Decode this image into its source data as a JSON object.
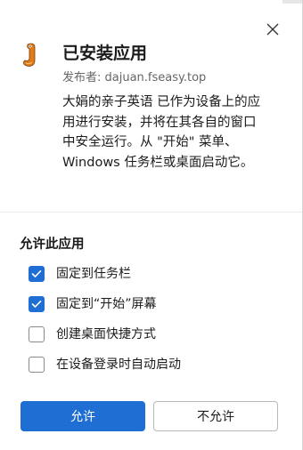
{
  "dialog": {
    "title": "已安装应用",
    "publisher": "发布者: dajuan.fseasy.top",
    "description": "大娟的亲子英语 已作为设备上的应用进行安装，并将在其各自的窗口中安全运行。从 \"开始\" 菜单、Windows 任务栏或桌面启动它。"
  },
  "permissions": {
    "title": "允许此应用",
    "options": [
      {
        "label": "固定到任务栏",
        "checked": true
      },
      {
        "label": "固定到“开始”屏幕",
        "checked": true
      },
      {
        "label": "创建桌面快捷方式",
        "checked": false
      },
      {
        "label": "在设备登录时自动启动",
        "checked": false
      }
    ]
  },
  "actions": {
    "allow_label": "允许",
    "deny_label": "不允许"
  },
  "icons": {
    "close": "close-icon",
    "app": "app-icon",
    "check": "checkmark-icon"
  },
  "colors": {
    "accent": "#1f6ed4",
    "app_icon_orange": "#e07b1a"
  }
}
